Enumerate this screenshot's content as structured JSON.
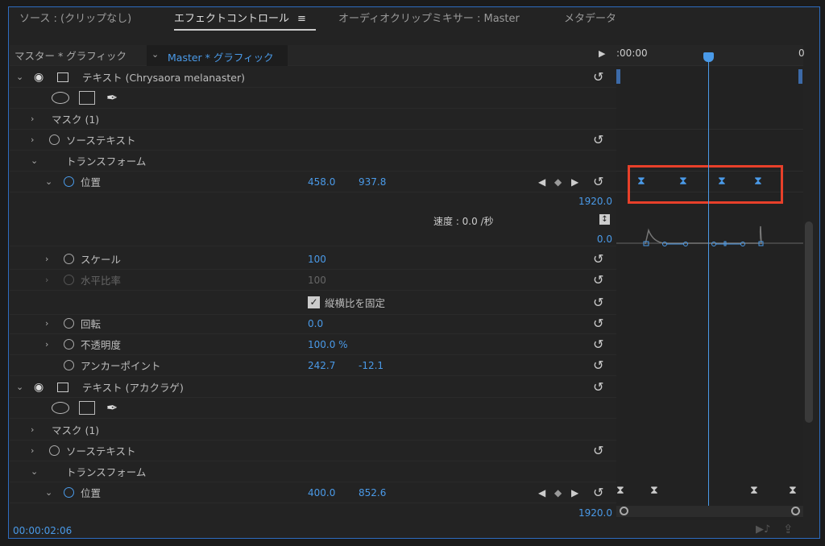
{
  "tabs": [
    {
      "label": "ソース : (クリップなし)"
    },
    {
      "label": "エフェクトコントロール"
    },
    {
      "label": "オーディオクリップミキサー : Master"
    },
    {
      "label": "メタデータ"
    }
  ],
  "menu_icon": "hamburger-icon",
  "header": {
    "master_clip": "マスター * グラフィック",
    "current_clip": "Master * グラフィック",
    "timecode_start": ":00:00",
    "timecode_end": "0"
  },
  "layer1": {
    "title": "テキスト (Chrysaora melanaster)",
    "mask": "マスク (1)",
    "source_text": "ソーステキスト",
    "transform": "トランスフォーム",
    "position": {
      "label": "位置",
      "x": "458.0",
      "y": "937.8",
      "max": "1920.0",
      "speed": "速度 : 0.0 /秒",
      "min": "0.0"
    },
    "scale": {
      "label": "スケール",
      "value": "100"
    },
    "h_scale": {
      "label": "水平比率",
      "value": "100"
    },
    "lock": {
      "label": "縦横比を固定",
      "checked": true
    },
    "rotation": {
      "label": "回転",
      "value": "0.0"
    },
    "opacity": {
      "label": "不透明度",
      "value": "100.0 %"
    },
    "anchor": {
      "label": "アンカーポイント",
      "x": "242.7",
      "y": "-12.1"
    }
  },
  "layer2": {
    "title": "テキスト (アカクラゲ)",
    "mask": "マスク (1)",
    "source_text": "ソーステキスト",
    "transform": "トランスフォーム",
    "position": {
      "label": "位置",
      "x": "400.0",
      "y": "852.6",
      "max": "1920.0"
    }
  },
  "footer": {
    "timecode": "00:00:02:06"
  },
  "colors": {
    "accent": "#4a9ae8",
    "highlight": "#e8402a",
    "panel_border": "#2d6cc0"
  }
}
